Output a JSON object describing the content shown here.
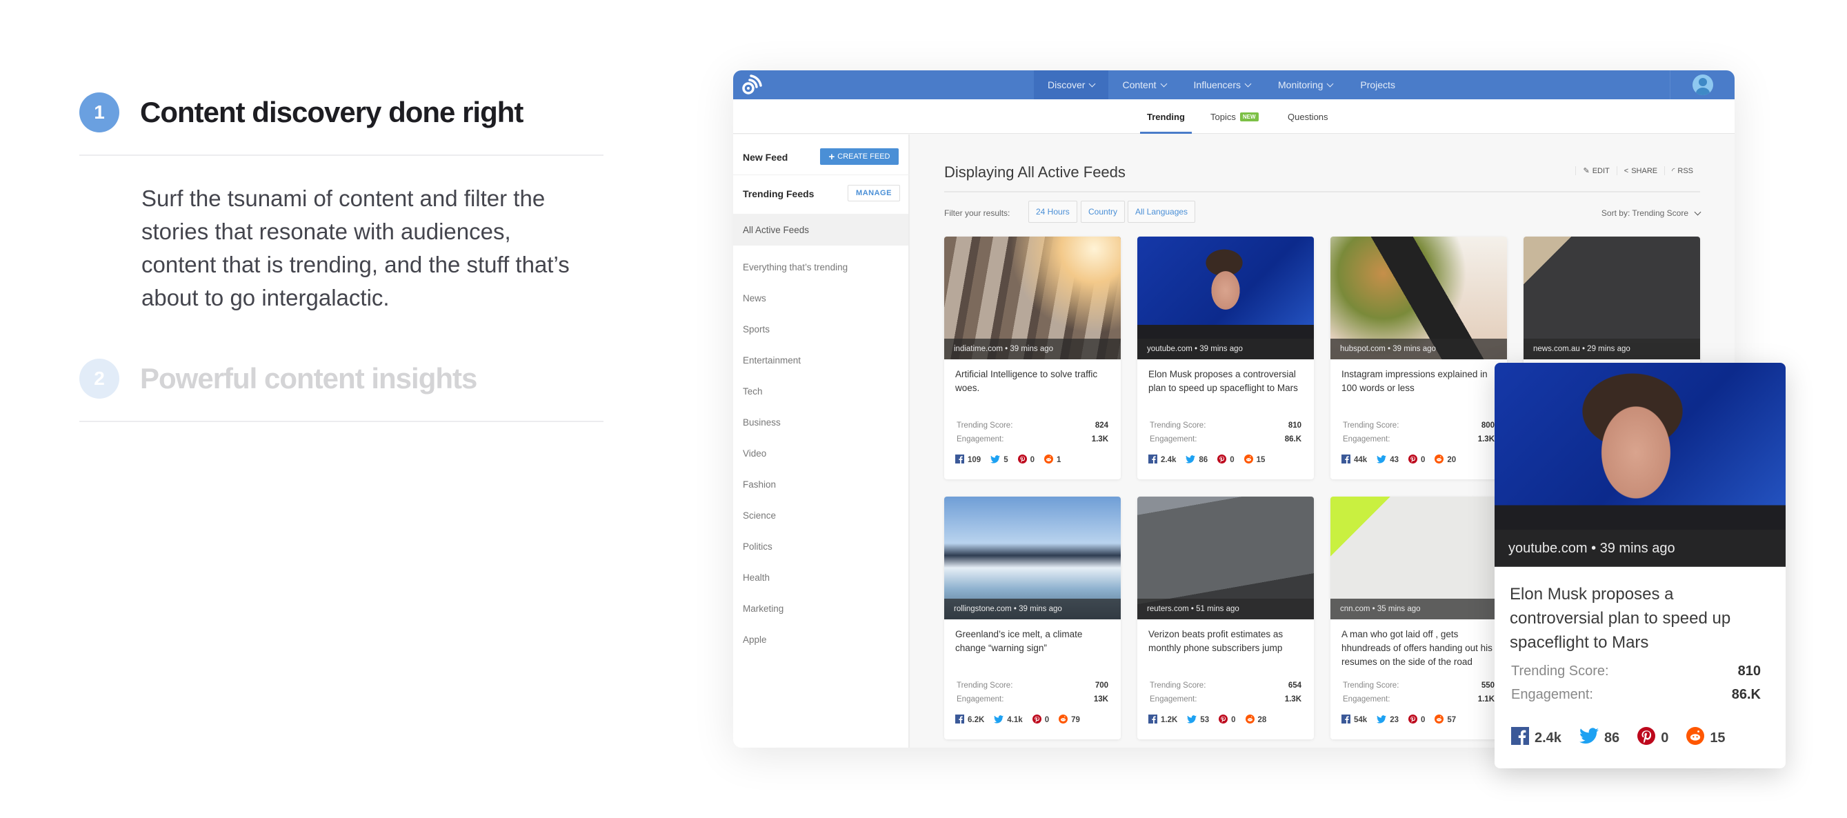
{
  "steps": [
    {
      "number": "1",
      "title": "Content discovery done right",
      "description": "Surf the tsunami of content and filter the stories that resonate with audiences, content that is trending, and the stuff that’s about to go intergalactic."
    },
    {
      "number": "2",
      "title": "Powerful content insights"
    }
  ],
  "app": {
    "brand_color": "#4a7cc9",
    "nav": [
      {
        "label": "Discover",
        "dropdown": true,
        "active": true
      },
      {
        "label": "Content",
        "dropdown": true
      },
      {
        "label": "Influencers",
        "dropdown": true
      },
      {
        "label": "Monitoring",
        "dropdown": true
      },
      {
        "label": "Projects",
        "dropdown": false
      }
    ],
    "subtabs": [
      {
        "label": "Trending",
        "active": true
      },
      {
        "label": "Topics",
        "badge": "NEW"
      },
      {
        "label": "Questions"
      }
    ],
    "sidebar": {
      "new_feed_label": "New Feed",
      "create_feed_label": "CREATE FEED",
      "trending_feeds_label": "Trending Feeds",
      "manage_label": "MANAGE",
      "items": [
        "All Active Feeds",
        "Everything that’s trending",
        "News",
        "Sports",
        "Entertainment",
        "Tech",
        "Business",
        "Video",
        "Fashion",
        "Science",
        "Politics",
        "Health",
        "Marketing",
        "Apple"
      ],
      "active_item": "All Active Feeds"
    },
    "main": {
      "title": "Displaying All Active Feeds",
      "actions": [
        "EDIT",
        "SHARE",
        "RSS"
      ],
      "filter_label": "Filter your results:",
      "filters": [
        "24 Hours",
        "Country",
        "All Languages"
      ],
      "sort_label": "Sort by: Trending Score",
      "score_label": "Trending Score:",
      "engagement_label": "Engagement:"
    },
    "cards": [
      {
        "source": "indiatime.com • 39 mins ago",
        "headline": "Artificial Intelligence to solve traffic woes.",
        "score": "824",
        "engagement": "1.3K",
        "facebook": "109",
        "twitter": "5",
        "pinterest": "0",
        "reddit": "1",
        "image": "traffic-jam"
      },
      {
        "source": "youtube.com • 39 mins ago",
        "headline": "Elon Musk proposes a controversial plan to speed up spaceflight to Mars",
        "score": "810",
        "engagement": "86.K",
        "facebook": "2.4k",
        "twitter": "86",
        "pinterest": "0",
        "reddit": "15",
        "image": "elon-musk-portrait"
      },
      {
        "source": "hubspot.com • 39 mins ago",
        "headline": "Instagram impressions explained in 100 words  or less",
        "score": "800",
        "engagement": "1.3K",
        "facebook": "44k",
        "twitter": "43",
        "pinterest": "0",
        "reddit": "20",
        "image": "phone-food-photo"
      },
      {
        "source": "news.com.au • 29 mins ago",
        "headline": "",
        "score": "",
        "engagement": "",
        "facebook": "",
        "twitter": "",
        "pinterest": "",
        "reddit": "",
        "image": "chalkboard-math"
      },
      {
        "source": "rollingstone.com • 39 mins ago",
        "headline": "Greenland’s ice melt, a climate change “warning sign”",
        "score": "700",
        "engagement": "13K",
        "facebook": "6.2K",
        "twitter": "4.1k",
        "pinterest": "0",
        "reddit": "79",
        "image": "icebergs"
      },
      {
        "source": "reuters.com • 51 mins ago",
        "headline": "Verizon beats profit estimates as monthly phone subscribers jump",
        "score": "654",
        "engagement": "1.3K",
        "facebook": "1.2K",
        "twitter": "53",
        "pinterest": "0",
        "reddit": "28",
        "image": "verizon-sign"
      },
      {
        "source": "cnn.com • 35 mins ago",
        "headline": "A man who got laid off , gets hhundreads of offers handing out his resumes on the side of the road",
        "score": "550",
        "engagement": "1.1K",
        "facebook": "54k",
        "twitter": "23",
        "pinterest": "0",
        "reddit": "57",
        "image": "resume-sign"
      }
    ],
    "popup": {
      "source": "youtube.com • 39 mins ago",
      "headline": "Elon Musk proposes a controversial plan to speed up spaceflight to Mars",
      "score": "810",
      "engagement": "86.K",
      "facebook": "2.4k",
      "twitter": "86",
      "pinterest": "0",
      "reddit": "15"
    }
  }
}
